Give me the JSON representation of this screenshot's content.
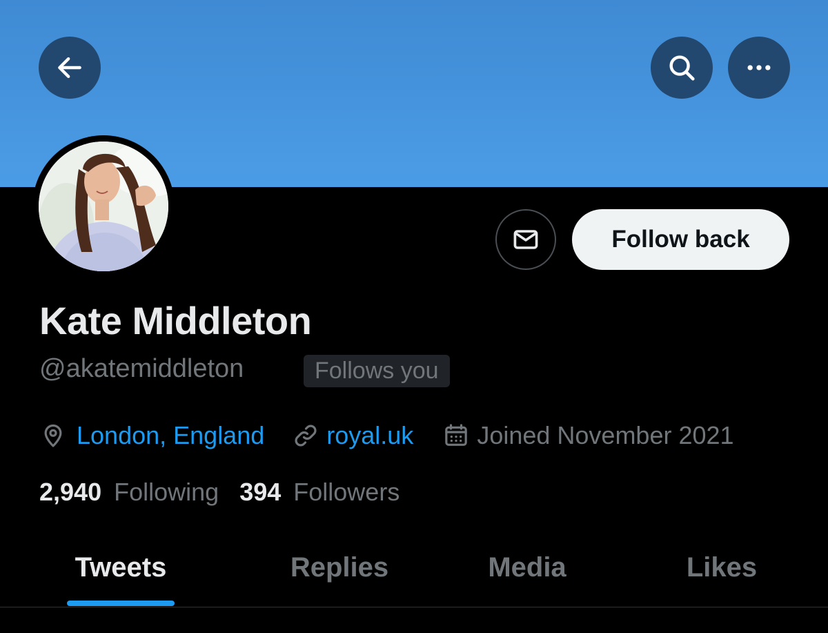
{
  "colors": {
    "accent": "#1d9bf0",
    "banner": "#4b9ce6",
    "background": "#000000",
    "muted": "#71767b"
  },
  "header": {
    "back_icon": "arrow-left-icon",
    "search_icon": "search-icon",
    "more_icon": "more-horizontal-icon"
  },
  "profile": {
    "name": "Kate Middleton",
    "handle": "@akatemiddleton",
    "follows_you": "Follows you",
    "follow_button": "Follow back",
    "message_icon": "envelope-icon",
    "location": "London, England",
    "website": "royal.uk",
    "joined": "Joined November 2021"
  },
  "stats": {
    "following_count": "2,940",
    "following_label": "Following",
    "followers_count": "394",
    "followers_label": "Followers"
  },
  "tabs": [
    {
      "label": "Tweets",
      "active": true
    },
    {
      "label": "Replies",
      "active": false
    },
    {
      "label": "Media",
      "active": false
    },
    {
      "label": "Likes",
      "active": false
    }
  ]
}
